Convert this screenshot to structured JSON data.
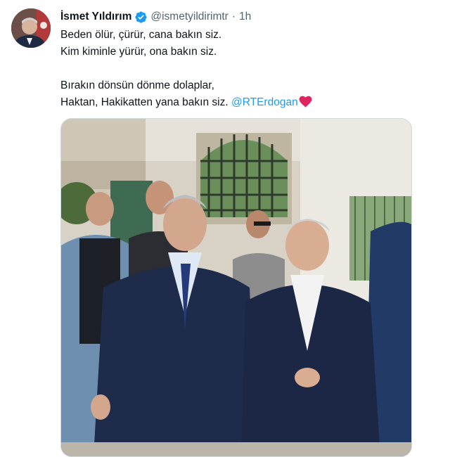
{
  "tweet": {
    "display_name": "İsmet Yıldırım",
    "handle": "@ismetyildirimtr",
    "separator": "·",
    "time": "1h",
    "verified_icon": "verified-badge-icon",
    "lines": [
      "Beden ölür, çürür, cana bakın siz.",
      "Kim kiminle yürür, ona bakın siz.",
      "",
      "Bırakın dönsün dönme dolaplar,"
    ],
    "last_line_text": "Haktan, Hakikatten yana bakın siz. ",
    "mention": "@RTErdogan",
    "emoji_icon": "red-heart-icon",
    "colors": {
      "accent": "#1d9bf0",
      "heart": "#e0245e",
      "text": "#0f1419",
      "secondary": "#536471"
    }
  }
}
